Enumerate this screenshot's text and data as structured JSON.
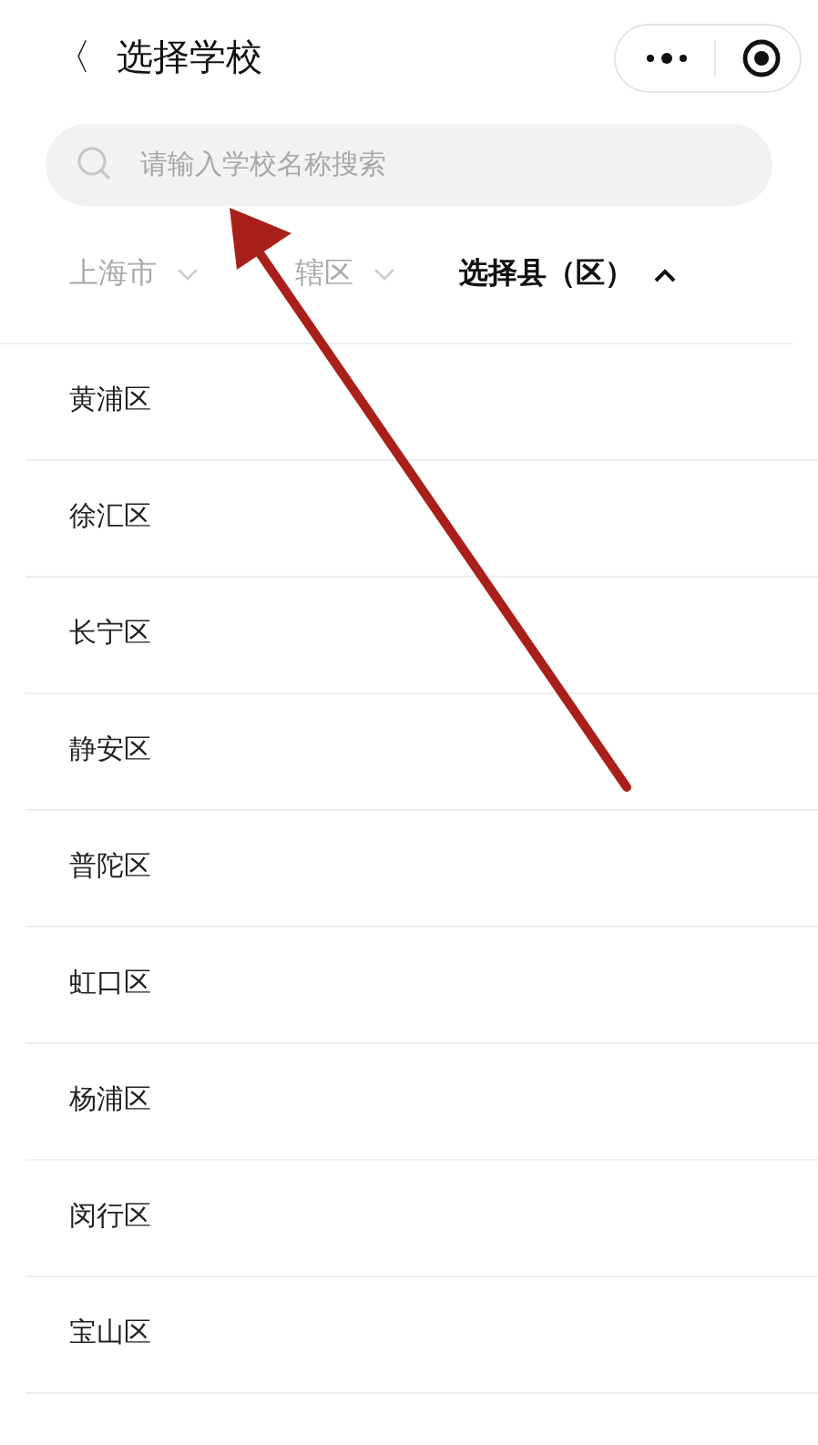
{
  "header": {
    "back": "〈",
    "title": "选择学校"
  },
  "search": {
    "placeholder": "请输入学校名称搜索"
  },
  "tabs": [
    {
      "label": "上海市",
      "selected": false
    },
    {
      "label": "辖区",
      "selected": false
    },
    {
      "label": "选择县（区）",
      "selected": true
    }
  ],
  "districts": [
    "黄浦区",
    "徐汇区",
    "长宁区",
    "静安区",
    "普陀区",
    "虹口区",
    "杨浦区",
    "闵行区",
    "宝山区"
  ]
}
